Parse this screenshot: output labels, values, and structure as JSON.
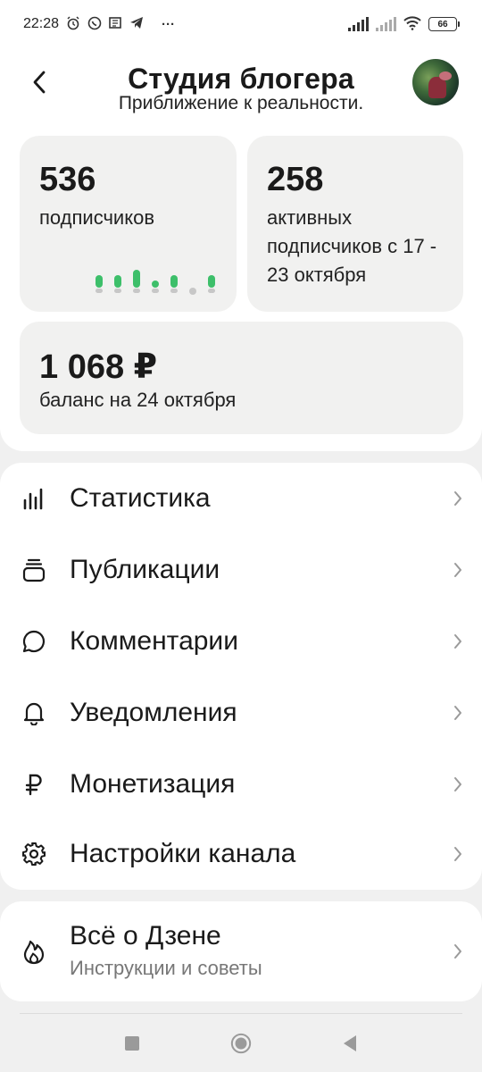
{
  "status_bar": {
    "time": "22:28",
    "more": "···",
    "battery": "66"
  },
  "header": {
    "title": "Студия блогера",
    "subtitle": "Приближение к реальности."
  },
  "stats": {
    "subscribers": {
      "value": "536",
      "label": "подписчиков"
    },
    "active": {
      "value": "258",
      "label": "активных подписчиков с 17 - 23 октября"
    },
    "balance": {
      "value": "1 068 ₽",
      "label": "баланс на 24 октября"
    }
  },
  "chart_data": {
    "type": "bar",
    "categories": [
      "1",
      "2",
      "3",
      "4",
      "5",
      "6",
      "7"
    ],
    "values": [
      2,
      2,
      3,
      1,
      2,
      -1,
      2
    ],
    "ylim": [
      -2,
      4
    ],
    "colors": {
      "positive": "#3dbf6a",
      "negative": "#c7c7c7"
    }
  },
  "menu": {
    "items": [
      {
        "label": "Статистика",
        "icon": "stats-icon"
      },
      {
        "label": "Публикации",
        "icon": "publications-icon"
      },
      {
        "label": "Комментарии",
        "icon": "comment-icon"
      },
      {
        "label": "Уведомления",
        "icon": "bell-icon"
      },
      {
        "label": "Монетизация",
        "icon": "ruble-icon"
      },
      {
        "label": "Настройки канала",
        "icon": "gear-icon"
      }
    ]
  },
  "zen": {
    "title": "Всё о Дзене",
    "subtitle": "Инструкции и советы",
    "icon": "flame-icon"
  },
  "colors": {
    "accent_green": "#3dbf6a",
    "card_bg": "#f1f1f0",
    "page_bg": "#f0f0f0"
  }
}
